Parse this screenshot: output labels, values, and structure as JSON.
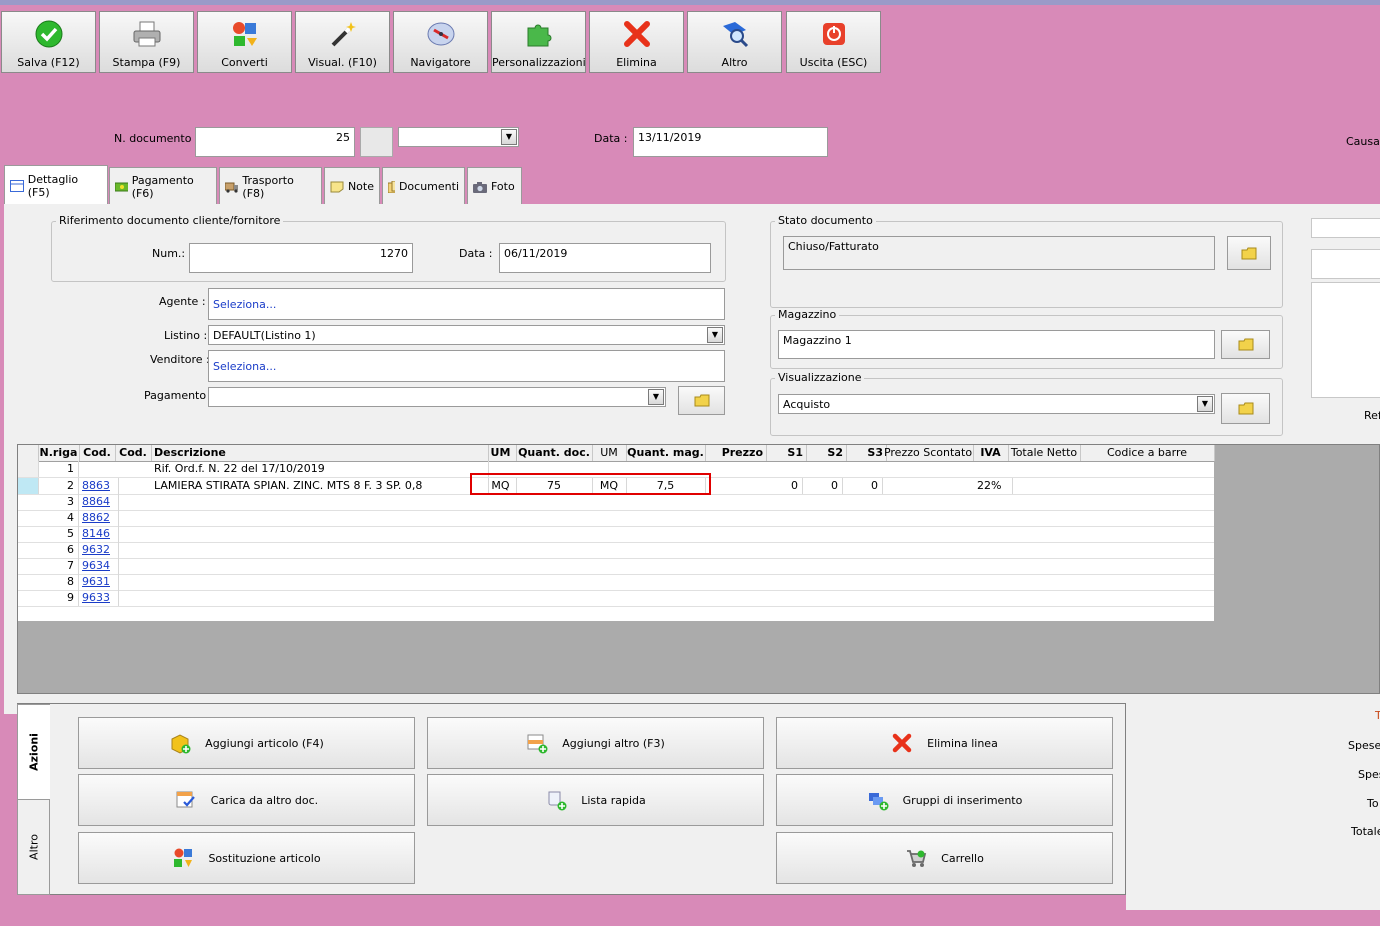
{
  "toolbar": {
    "salva": "Salva (F12)",
    "stampa": "Stampa (F9)",
    "converti": "Converti",
    "visual": "Visual. (F10)",
    "navigatore": "Navigatore",
    "personalizzazioni": "Personalizzazioni",
    "elimina": "Elimina",
    "altro": "Altro",
    "uscita": "Uscita (ESC)"
  },
  "header": {
    "ndoc_label": "N. documento :",
    "ndoc_value": "25",
    "data_label": "Data :",
    "data_value": "13/11/2019",
    "causale_label": "Causal"
  },
  "tabs": {
    "dettaglio": "Dettaglio (F5)",
    "pagamento": "Pagamento (F6)",
    "trasporto": "Trasporto (F8)",
    "note": "Note",
    "documenti": "Documenti",
    "foto": "Foto"
  },
  "riferimento": {
    "title": "Riferimento documento cliente/fornitore",
    "num_label": "Num.:",
    "num_value": "1270",
    "data_label": "Data :",
    "data_value": "06/11/2019"
  },
  "form": {
    "agente_label": "Agente :",
    "agente_value": "Seleziona...",
    "listino_label": "Listino :",
    "listino_value": "DEFAULT(Listino 1)",
    "venditore_label": "Venditore :",
    "venditore_value": "Seleziona...",
    "pagamento_label": "Pagamento :",
    "pagamento_value": ""
  },
  "stato": {
    "title": "Stato documento",
    "value": "Chiuso/Fatturato"
  },
  "magazzino": {
    "title": "Magazzino",
    "value": "Magazzino 1"
  },
  "visualizzazione": {
    "title": "Visualizzazione",
    "value": "Acquisto"
  },
  "right_partial": {
    "ref": "Ref"
  },
  "grid": {
    "headers": {
      "nriga": "N.riga",
      "cod": "Cod.",
      "cod2": "Cod.",
      "descrizione": "Descrizione",
      "um": "UM",
      "qdoc": "Quant. doc.",
      "um2": "UM",
      "qmag": "Quant. mag.",
      "prezzo": "Prezzo",
      "s1": "S1",
      "s2": "S2",
      "s3": "S3",
      "sconto": "Prezzo Scontato",
      "iva": "IVA",
      "netto": "Totale Netto",
      "barre": "Codice a barre"
    },
    "rows": [
      {
        "n": "1",
        "cod": "",
        "desc": "Rif. Ord.f. N. 22 del 17/10/2019",
        "um": "",
        "qdoc": "",
        "um2": "",
        "qmag": "",
        "s1": "",
        "s2": "",
        "s3": "",
        "iva": ""
      },
      {
        "n": "2",
        "cod": "8863",
        "desc": "LAMIERA STIRATA SPIAN. ZINC. MTS  8 F. 3 SP. 0,8",
        "um": "MQ",
        "qdoc": "75",
        "um2": "MQ",
        "qmag": "7,5",
        "s1": "0",
        "s2": "0",
        "s3": "0",
        "iva": "22%"
      },
      {
        "n": "3",
        "cod": "8864"
      },
      {
        "n": "4",
        "cod": "8862"
      },
      {
        "n": "5",
        "cod": "8146"
      },
      {
        "n": "6",
        "cod": "9632"
      },
      {
        "n": "7",
        "cod": "9634"
      },
      {
        "n": "8",
        "cod": "9631"
      },
      {
        "n": "9",
        "cod": "9633"
      }
    ]
  },
  "actions": {
    "tab_azioni": "Azioni",
    "tab_altro": "Altro",
    "aggiungi_articolo": "Aggiungi articolo (F4)",
    "aggiungi_altro": "Aggiungi altro (F3)",
    "elimina_linea": "Elimina linea",
    "carica_altro_doc": "Carica da altro doc.",
    "lista_rapida": "Lista rapida",
    "gruppi_inserimento": "Gruppi di inserimento",
    "sostituzione": "Sostituzione articolo",
    "carrello": "Carrello"
  },
  "totals_partial": {
    "t1": "T",
    "spese1": "Spese",
    "spese2": "Spes",
    "to": "To",
    "totale": "Totale"
  }
}
